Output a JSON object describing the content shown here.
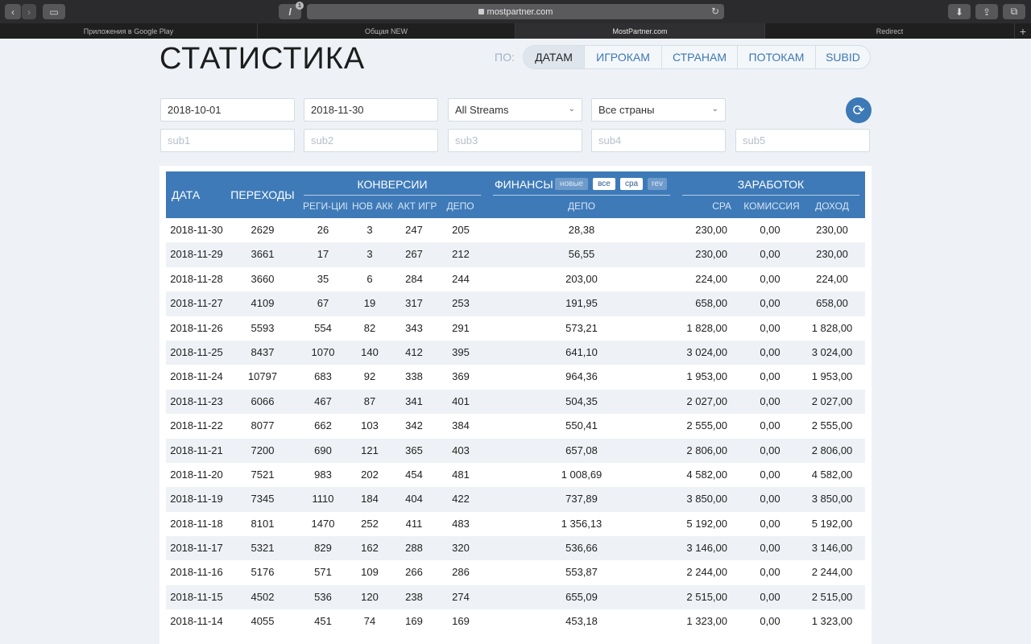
{
  "browser": {
    "tab_count_badge": "1",
    "url": "mostpartner.com",
    "tabs": [
      {
        "label": "Приложения в Google Play"
      },
      {
        "label": "Общая NEW"
      },
      {
        "label": "MostPartner.com"
      },
      {
        "label": "Redirect"
      }
    ],
    "new_tab": "+"
  },
  "page": {
    "title": "СТАТИСТИКА",
    "group_by_label": "ПО:",
    "group_by": [
      {
        "label": "ДАТАМ",
        "active": true
      },
      {
        "label": "ИГРОКАМ",
        "active": false
      },
      {
        "label": "СТРАНАМ",
        "active": false
      },
      {
        "label": "ПОТОКАМ",
        "active": false
      },
      {
        "label": "SUBID",
        "active": false
      }
    ]
  },
  "filters": {
    "date_from": "2018-10-01",
    "date_to": "2018-11-30",
    "stream": "All Streams",
    "country": "Все страны",
    "sub1": "sub1",
    "sub2": "sub2",
    "sub3": "sub3",
    "sub4": "sub4",
    "sub5": "sub5"
  },
  "table": {
    "headers": {
      "date": "ДАТА",
      "clicks": "ПЕРЕХОДЫ",
      "conversions": "КОНВЕРСИИ",
      "finance": "ФИНАНСЫ",
      "earnings": "ЗАРАБОТОК",
      "conv_sub": [
        "РЕГИ-ЦИЙ",
        "НОВ АКК",
        "АКТ ИГР",
        "ДЕПО"
      ],
      "fin_sub": "ДЕПО",
      "earn_sub": [
        "CPA",
        "КОМИССИЯ",
        "ДОХОД"
      ],
      "fin_badges": [
        {
          "label": "новые",
          "on": false
        },
        {
          "label": "все",
          "on": true
        },
        {
          "label": "cpa",
          "on": true
        },
        {
          "label": "rev",
          "on": false
        }
      ]
    },
    "rows": [
      [
        "2018-11-30",
        "2629",
        "26",
        "3",
        "247",
        "205",
        "28,38",
        "230,00",
        "0,00",
        "230,00"
      ],
      [
        "2018-11-29",
        "3661",
        "17",
        "3",
        "267",
        "212",
        "56,55",
        "230,00",
        "0,00",
        "230,00"
      ],
      [
        "2018-11-28",
        "3660",
        "35",
        "6",
        "284",
        "244",
        "203,00",
        "224,00",
        "0,00",
        "224,00"
      ],
      [
        "2018-11-27",
        "4109",
        "67",
        "19",
        "317",
        "253",
        "191,95",
        "658,00",
        "0,00",
        "658,00"
      ],
      [
        "2018-11-26",
        "5593",
        "554",
        "82",
        "343",
        "291",
        "573,21",
        "1 828,00",
        "0,00",
        "1 828,00"
      ],
      [
        "2018-11-25",
        "8437",
        "1070",
        "140",
        "412",
        "395",
        "641,10",
        "3 024,00",
        "0,00",
        "3 024,00"
      ],
      [
        "2018-11-24",
        "10797",
        "683",
        "92",
        "338",
        "369",
        "964,36",
        "1 953,00",
        "0,00",
        "1 953,00"
      ],
      [
        "2018-11-23",
        "6066",
        "467",
        "87",
        "341",
        "401",
        "504,35",
        "2 027,00",
        "0,00",
        "2 027,00"
      ],
      [
        "2018-11-22",
        "8077",
        "662",
        "103",
        "342",
        "384",
        "550,41",
        "2 555,00",
        "0,00",
        "2 555,00"
      ],
      [
        "2018-11-21",
        "7200",
        "690",
        "121",
        "365",
        "403",
        "657,08",
        "2 806,00",
        "0,00",
        "2 806,00"
      ],
      [
        "2018-11-20",
        "7521",
        "983",
        "202",
        "454",
        "481",
        "1 008,69",
        "4 582,00",
        "0,00",
        "4 582,00"
      ],
      [
        "2018-11-19",
        "7345",
        "1110",
        "184",
        "404",
        "422",
        "737,89",
        "3 850,00",
        "0,00",
        "3 850,00"
      ],
      [
        "2018-11-18",
        "8101",
        "1470",
        "252",
        "411",
        "483",
        "1 356,13",
        "5 192,00",
        "0,00",
        "5 192,00"
      ],
      [
        "2018-11-17",
        "5321",
        "829",
        "162",
        "288",
        "320",
        "536,66",
        "3 146,00",
        "0,00",
        "3 146,00"
      ],
      [
        "2018-11-16",
        "5176",
        "571",
        "109",
        "266",
        "286",
        "553,87",
        "2 244,00",
        "0,00",
        "2 244,00"
      ],
      [
        "2018-11-15",
        "4502",
        "536",
        "120",
        "238",
        "274",
        "655,09",
        "2 515,00",
        "0,00",
        "2 515,00"
      ],
      [
        "2018-11-14",
        "4055",
        "451",
        "74",
        "169",
        "169",
        "453,18",
        "1 323,00",
        "0,00",
        "1 323,00"
      ]
    ]
  }
}
